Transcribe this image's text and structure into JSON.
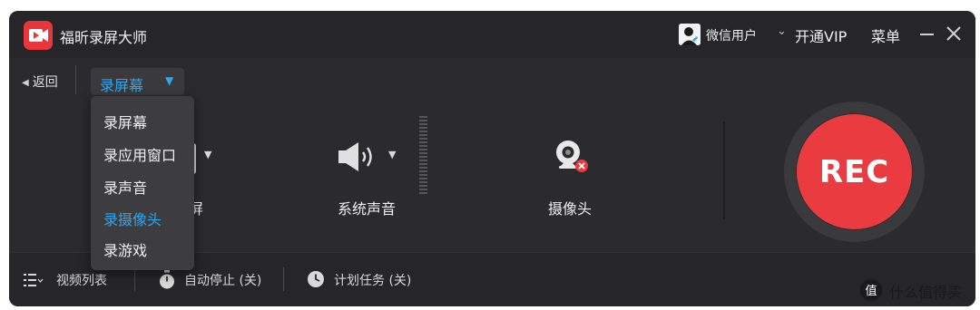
{
  "app": {
    "title": "福昕录屏大师"
  },
  "titlebar": {
    "user_name": "微信用户",
    "vip_label": "开通VIP",
    "menu_label": "菜单"
  },
  "toolbar": {
    "back_label": "返回",
    "mode_selected": "录屏幕"
  },
  "dropdown": {
    "items": [
      {
        "label": "录屏幕",
        "selected": false
      },
      {
        "label": "录应用窗口",
        "selected": false
      },
      {
        "label": "录声音",
        "selected": false
      },
      {
        "label": "录摄像头",
        "selected": true
      },
      {
        "label": "录游戏",
        "selected": false
      }
    ]
  },
  "panels": {
    "screen_label_fragment": "屏",
    "audio_label": "系统声音",
    "camera_label": "摄像头"
  },
  "rec": {
    "label": "REC",
    "color": "#ea3c40"
  },
  "bottombar": {
    "video_list": "视频列表",
    "auto_stop": "自动停止 (关)",
    "schedule": "计划任务 (关)"
  },
  "watermark": {
    "text": "什么值得买"
  },
  "colors": {
    "accent": "#2aa8f2",
    "background": "#2b2b2d"
  }
}
